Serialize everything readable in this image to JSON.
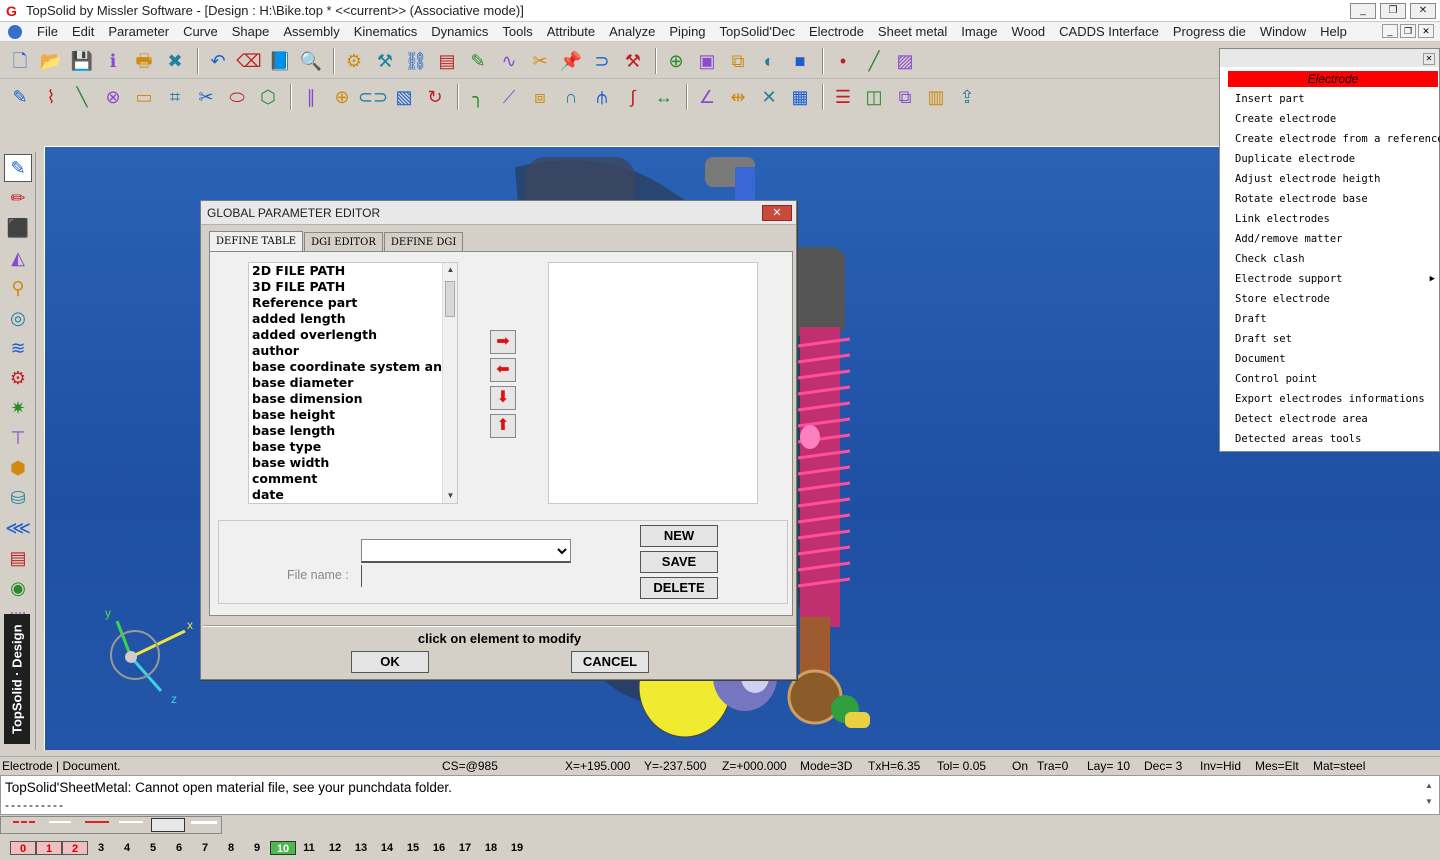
{
  "window": {
    "title": "TopSolid by Missler Software - [Design : H:\\Bike.top *  <<current>> (Associative mode)]",
    "controls": [
      "_",
      "❐",
      "✕"
    ]
  },
  "menubar": {
    "items": [
      "File",
      "Edit",
      "Parameter",
      "Curve",
      "Shape",
      "Assembly",
      "Kinematics",
      "Dynamics",
      "Tools",
      "Attribute",
      "Analyze",
      "Piping",
      "TopSolid'Dec",
      "Electrode",
      "Sheet metal",
      "Image",
      "Wood",
      "CADDS Interface",
      "Progress die",
      "Window",
      "Help"
    ]
  },
  "left_toolbar": {
    "brand": "TopSolid · Design"
  },
  "dialog": {
    "title": "GLOBAL PARAMETER EDITOR",
    "close": "✕",
    "tabs": [
      "DEFINE TABLE",
      "DGI EDITOR",
      "DEFINE DGI"
    ],
    "active_tab": "DEFINE TABLE",
    "list_items": [
      "2D FILE PATH",
      "3D FILE PATH",
      "Reference part",
      "added length",
      "added overlength",
      "author",
      "base coordinate system and",
      "base diameter",
      "base dimension",
      "base height",
      "base length",
      "base type",
      "base width",
      "comment",
      "date"
    ],
    "arrows": {
      "right": "➡",
      "left": "⬅",
      "down": "⬇",
      "up": "⬆"
    },
    "file_name_label": "File name :",
    "file_name_value": "",
    "selected_option": "",
    "buttons": {
      "new": "NEW",
      "save": "SAVE",
      "delete": "DELETE",
      "ok": "OK",
      "cancel": "CANCEL"
    },
    "hint": "click on element to modify"
  },
  "electrode_menu": {
    "title": "Electrode",
    "items": [
      "Insert part",
      "Create electrode",
      "Create electrode from a reference",
      "Duplicate electrode",
      "Adjust electrode heigth",
      "Rotate electrode base",
      "Link electrodes",
      "Add/remove matter",
      "Check clash",
      "Electrode support",
      "Store electrode",
      "Draft",
      "Draft set",
      "Document",
      "Control point",
      "Export electrodes informations",
      "Detect electrode area",
      "Detected areas tools"
    ],
    "submenu_item": "Electrode support"
  },
  "axis_labels": {
    "x": "x",
    "y": "y",
    "z": "z"
  },
  "statusbar": {
    "context": "Electrode | Document.",
    "cs": "CS=@985",
    "x": "X=+195.000",
    "y": "Y=-237.500",
    "z": "Z=+000.000",
    "mode": "Mode=3D",
    "txh": "TxH=6.35",
    "tol": "Tol=  0.05",
    "on": "On",
    "tra": "Tra=0",
    "lay": "Lay= 10",
    "dec": "Dec= 3",
    "inv": "Inv=Hid",
    "mes": "Mes=Elt",
    "mat": "Mat=steel"
  },
  "message": {
    "line1": "TopSolid'SheetMetal: Cannot open material file, see your punchdata folder.",
    "line2": "----------"
  },
  "layers": {
    "items": [
      "0",
      "1",
      "2",
      "3",
      "4",
      "5",
      "6",
      "7",
      "8",
      "9",
      "10",
      "11",
      "12",
      "13",
      "14",
      "15",
      "16",
      "17",
      "18",
      "19"
    ],
    "on": [
      "0",
      "1",
      "2"
    ],
    "current": "10"
  },
  "colors": {
    "viewport": "#2a62b6",
    "electrode_title_bg": "#ff0000",
    "arrow_red": "#e01010",
    "current_layer": "#4db84d"
  },
  "icons": {
    "toolbar1": [
      "new-file-icon",
      "open-file-icon",
      "save-icon",
      "info-icon",
      "print-icon",
      "delete-icon",
      "undo-icon",
      "eraser-icon",
      "catalog-icon",
      "zoom-icon",
      "settings-icon",
      "hammer-icon",
      "assembly-icon",
      "sheet-icon",
      "draw-icon",
      "curve-icon",
      "cut-icon",
      "pin-icon",
      "magnet-icon",
      "tools-icon",
      "zoom-window-icon",
      "fit-icon",
      "view-icon",
      "render-icon",
      "color-icon",
      "point-icon",
      "line-style-icon",
      "hatch-icon"
    ],
    "toolbar2": [
      "pencil-icon",
      "polyline-icon",
      "segment-icon",
      "circle-point-icon",
      "rectangle-icon",
      "frame-icon",
      "trim-icon",
      "ellipse-icon",
      "polygon-icon",
      "parallel-icon",
      "target-icon",
      "slot-icon",
      "box-icon",
      "sweep-icon",
      "fillet-icon",
      "chamfer-icon",
      "offset-icon",
      "arch-icon",
      "split-icon",
      "spring-icon",
      "dimension-icon",
      "angle-icon",
      "distance-icon",
      "cross-icon",
      "block-icon",
      "stack-icon",
      "part-icon",
      "attach-icon",
      "table-icon",
      "export-icon"
    ],
    "left": [
      "design-pencil-icon",
      "draft-icon",
      "solid-icon",
      "surface-icon",
      "tool-icon",
      "circle-icon",
      "wave-icon",
      "gear-icon",
      "star-icon",
      "beam-icon",
      "mold-icon",
      "cylinder-icon",
      "rail-icon",
      "sheet-icon",
      "analysis-icon",
      "parts-icon"
    ]
  }
}
